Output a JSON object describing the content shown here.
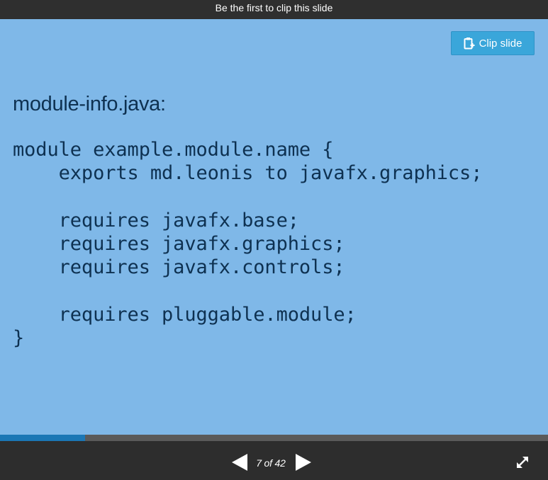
{
  "top_bar": {
    "text": "Be the first to clip this slide"
  },
  "clip_button": {
    "label": "Clip slide",
    "icon": "clipboard-icon"
  },
  "slide": {
    "heading": "module-info.java:",
    "code": "module example.module.name {\n    exports md.leonis to javafx.graphics;\n\n    requires javafx.base;\n    requires javafx.graphics;\n    requires javafx.controls;\n\n    requires pluggable.module;\n}",
    "background_color": "#7fb8e8",
    "text_color": "#0e3151"
  },
  "progress": {
    "fraction": 0.1548
  },
  "navigation": {
    "page_text": "7 of 42",
    "prev_icon": "triangle-left-icon",
    "next_icon": "triangle-right-icon",
    "fullscreen_icon": "expand-arrows-icon"
  }
}
